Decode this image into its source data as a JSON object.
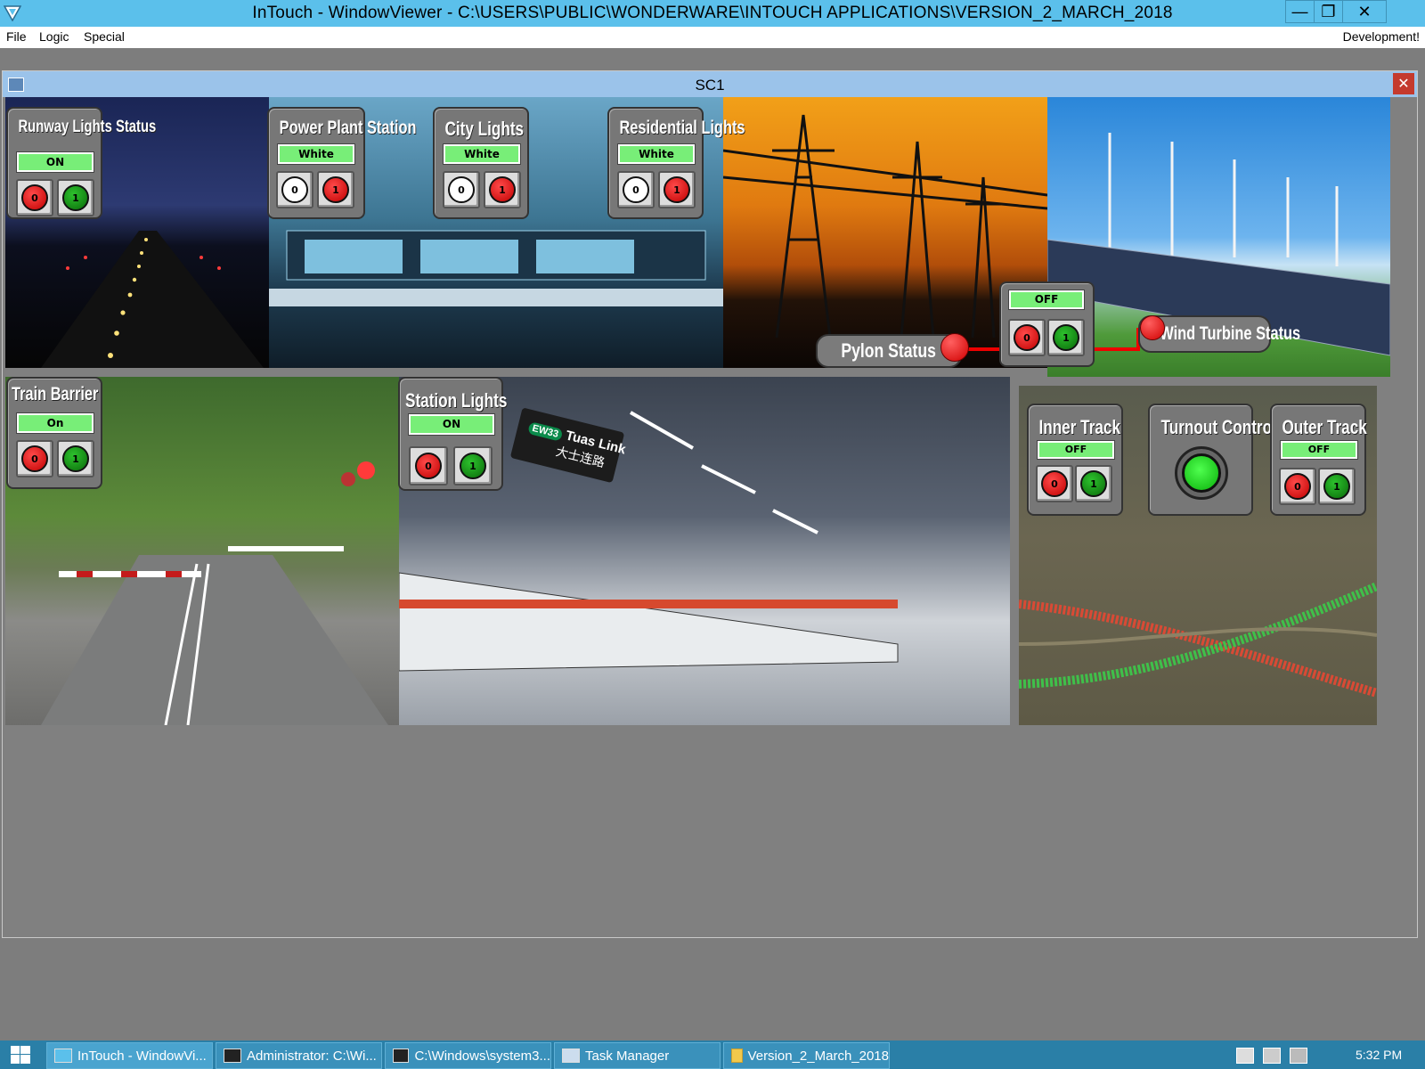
{
  "window": {
    "title": "InTouch - WindowViewer - C:\\USERS\\PUBLIC\\WONDERWARE\\INTOUCH APPLICATIONS\\VERSION_2_MARCH_2018"
  },
  "menu": {
    "file": "File",
    "logic": "Logic",
    "special": "Special",
    "development": "Development!"
  },
  "subwindow": {
    "title": "SC1"
  },
  "panels": {
    "runway": {
      "title": "Runway Lights Status",
      "status": "ON",
      "btn0": "0",
      "btn1": "1"
    },
    "power_plant": {
      "title": "Power Plant Station",
      "status": "White",
      "btn0": "0",
      "btn1": "1"
    },
    "city": {
      "title": "City Lights",
      "status": "White",
      "btn0": "0",
      "btn1": "1"
    },
    "residential": {
      "title": "Residential Lights",
      "status": "White",
      "btn0": "0",
      "btn1": "1"
    },
    "pylon": {
      "title": "Pylon Status",
      "status": "OFF",
      "btn0": "0",
      "btn1": "1"
    },
    "wind": {
      "title": "Wind Turbine Status"
    },
    "train_barrier": {
      "title": "Train Barrier",
      "status": "On",
      "btn0": "0",
      "btn1": "1"
    },
    "station": {
      "title": "Station Lights",
      "status": "ON",
      "btn0": "0",
      "btn1": "1"
    },
    "inner_track": {
      "title": "Inner Track",
      "status": "OFF",
      "btn0": "0",
      "btn1": "1"
    },
    "turnout": {
      "title": "Turnout Control"
    },
    "outer_track": {
      "title": "Outer Track",
      "status": "OFF",
      "btn0": "0",
      "btn1": "1"
    }
  },
  "station_sign": {
    "code": "EW33",
    "name": "Tuas Link",
    "chinese": "大士连路"
  },
  "taskbar": {
    "items": [
      "InTouch - WindowVi...",
      "Administrator: C:\\Wi...",
      "C:\\Windows\\system3...",
      "Task Manager",
      "Version_2_March_2018"
    ],
    "time": "5:32 PM"
  },
  "colors": {
    "titlebar": "#5bc0eb",
    "status_green": "#78ee78",
    "lamp_red": "#e00000",
    "lamp_green": "#0f8a0f"
  }
}
